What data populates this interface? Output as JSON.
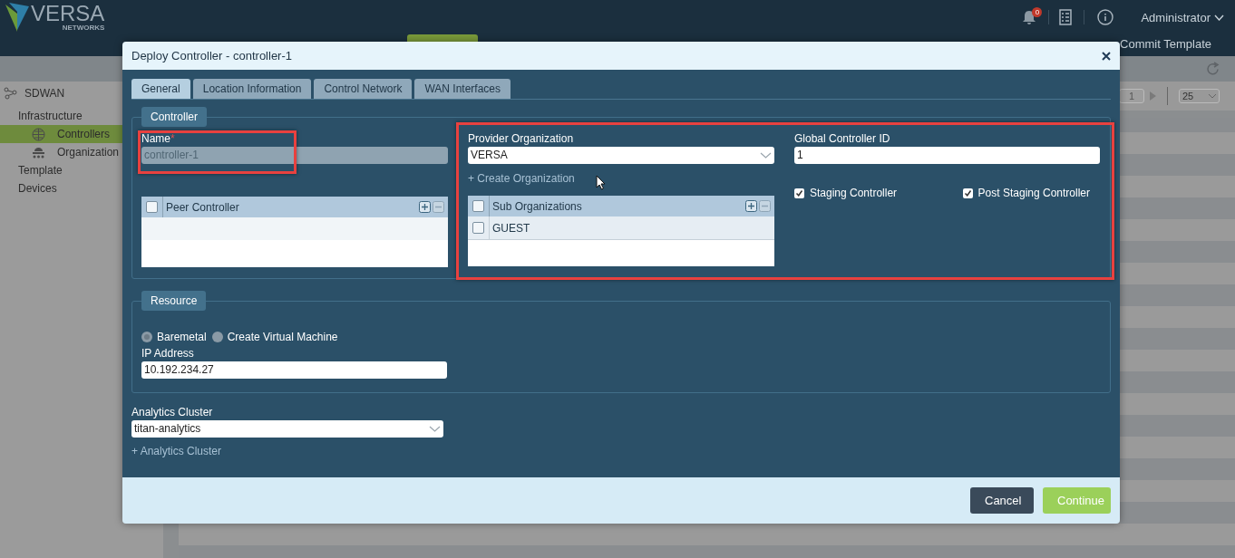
{
  "header": {
    "logo_text": "VERSA",
    "logo_subtext": "NETWORKS",
    "notification_count": "0",
    "user": "Administrator",
    "commit_button": "Commit Template"
  },
  "sidebar": {
    "root": "SDWAN",
    "items": [
      {
        "label": "Infrastructure",
        "selected": false,
        "children": [
          {
            "label": "Controllers",
            "selected": true
          },
          {
            "label": "Organization",
            "selected": false
          }
        ]
      },
      {
        "label": "Template",
        "selected": false
      },
      {
        "label": "Devices",
        "selected": false
      }
    ]
  },
  "pagination": {
    "page": "1",
    "page_size": "25"
  },
  "dialog": {
    "title": "Deploy Controller - controller-1",
    "tabs": [
      {
        "label": "General",
        "selected": true
      },
      {
        "label": "Location Information",
        "selected": false
      },
      {
        "label": "Control Network",
        "selected": false
      },
      {
        "label": "WAN Interfaces",
        "selected": false
      }
    ],
    "controller_section": {
      "legend": "Controller",
      "name": {
        "label": "Name",
        "required_mark": "*",
        "value": "controller-1",
        "disabled": true
      },
      "peer_table": {
        "header": "Peer Controller",
        "header_checked": false
      },
      "provider_organization": {
        "label": "Provider Organization",
        "value": "VERSA"
      },
      "create_org_link": "+ Create Organization",
      "sub_org_table": {
        "header": "Sub Organizations",
        "header_checked": false,
        "rows": [
          {
            "label": "GUEST",
            "checked": false
          }
        ]
      },
      "global_controller_id": {
        "label": "Global Controller ID",
        "value": "1"
      },
      "options": [
        {
          "label": "Staging Controller",
          "checked": true
        },
        {
          "label": "Post Staging Controller",
          "checked": true
        }
      ]
    },
    "resource_section": {
      "legend": "Resource",
      "modes": [
        {
          "label": "Baremetal",
          "selected": true
        },
        {
          "label": "Create Virtual Machine",
          "selected": false
        }
      ],
      "ip_address": {
        "label": "IP Address",
        "value": "10.192.234.27"
      }
    },
    "analytics_cluster": {
      "label": "Analytics Cluster",
      "value": "titan-analytics"
    },
    "add_cluster_link": "+ Analytics Cluster",
    "buttons": [
      {
        "label": "Cancel",
        "kind": "secondary"
      },
      {
        "label": "Continue",
        "kind": "primary"
      }
    ]
  }
}
